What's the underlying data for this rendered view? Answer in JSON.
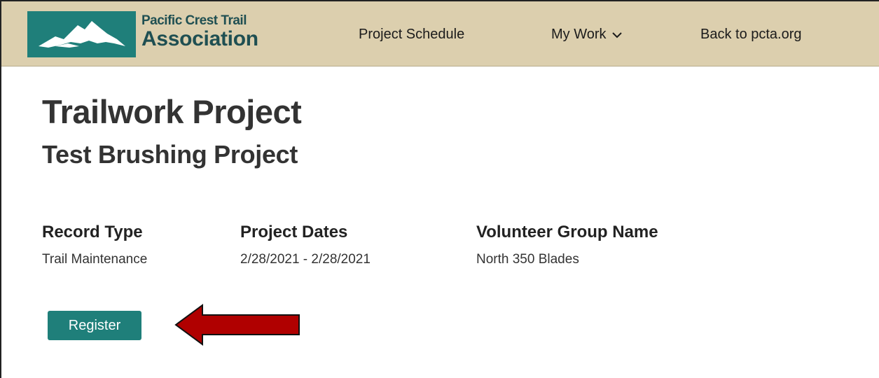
{
  "header": {
    "logo": {
      "line1": "Pacific Crest Trail",
      "line2": "Association"
    },
    "nav": {
      "schedule": "Project Schedule",
      "my_work": "My Work",
      "back": "Back to pcta.org"
    }
  },
  "page": {
    "title": "Trailwork Project",
    "subtitle": "Test Brushing Project"
  },
  "fields": [
    {
      "label": "Record Type",
      "value": "Trail Maintenance"
    },
    {
      "label": "Project Dates",
      "value": "2/28/2021 - 2/28/2021"
    },
    {
      "label": "Volunteer Group Name",
      "value": "North 350 Blades"
    }
  ],
  "actions": {
    "register_label": "Register"
  },
  "colors": {
    "header_bg": "#dccfae",
    "brand_teal": "#1f7f7a",
    "logo_text": "#1f4f52",
    "arrow": "#b00000"
  },
  "icons": {
    "logo": "mountain-logo-icon",
    "dropdown": "chevron-down-icon",
    "annotation": "arrow-left-icon"
  }
}
